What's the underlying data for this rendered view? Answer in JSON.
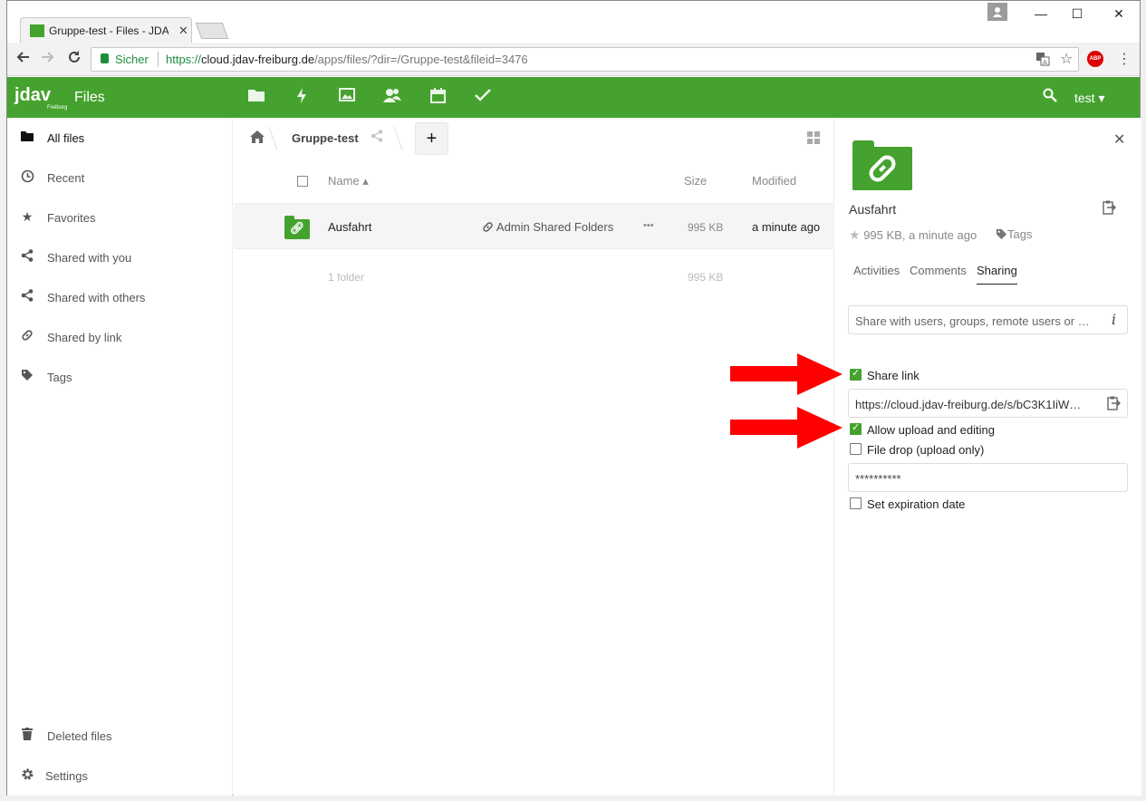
{
  "browser": {
    "tab_title": "Gruppe-test - Files - JDAV",
    "tab_close": "✕",
    "security_label": "Sicher",
    "url_proto": "https://",
    "url_host": "cloud.jdav-freiburg.de",
    "url_path": "/apps/files/?dir=/Gruppe-test&fileid=3476",
    "abp": "ABP",
    "window_min": "—",
    "window_max": "☐",
    "window_close": "✕"
  },
  "header": {
    "logo": "jdav",
    "logo_sub": "Freiburg",
    "app_title": "Files",
    "user": "test ▾",
    "app_icons": [
      "folder-icon",
      "activity-icon",
      "gallery-icon",
      "contacts-icon",
      "calendar-icon",
      "tasks-icon"
    ]
  },
  "sidebar": {
    "items": [
      {
        "label": "All files",
        "icon": "folder-icon"
      },
      {
        "label": "Recent",
        "icon": "clock-icon"
      },
      {
        "label": "Favorites",
        "icon": "star-icon"
      },
      {
        "label": "Shared with you",
        "icon": "share-icon"
      },
      {
        "label": "Shared with others",
        "icon": "share-icon"
      },
      {
        "label": "Shared by link",
        "icon": "link-icon"
      },
      {
        "label": "Tags",
        "icon": "tag-icon"
      }
    ],
    "deleted": "Deleted files",
    "settings": "Settings"
  },
  "main": {
    "breadcrumb_folder": "Gruppe-test",
    "add_label": "+",
    "columns": {
      "name": "Name ▴",
      "size": "Size",
      "modified": "Modified"
    },
    "rows": [
      {
        "name": "Ausfahrt",
        "share": "Admin Shared Folders",
        "actions": "•••",
        "size": "995 KB",
        "modified": "a minute ago"
      }
    ],
    "summary": {
      "count": "1 folder",
      "size": "995 KB"
    }
  },
  "panel": {
    "filename": "Ausfahrt",
    "meta": "995 KB, a minute ago",
    "tags": "Tags",
    "tabs": [
      "Activities",
      "Comments",
      "Sharing"
    ],
    "active_tab": "Sharing",
    "share_placeholder": "Share with users, groups, remote users or …",
    "share_link_label": "Share link",
    "share_link_checked": true,
    "share_url": "https://cloud.jdav-freiburg.de/s/bC3K1IiW…",
    "allow_upload_label": "Allow upload and editing",
    "allow_upload_checked": true,
    "file_drop_label": "File drop (upload only)",
    "file_drop_checked": false,
    "password": "**********",
    "expiration_label": "Set expiration date",
    "expiration_checked": false
  },
  "colors": {
    "brand": "#45a22e",
    "arrow": "#ff0000"
  }
}
